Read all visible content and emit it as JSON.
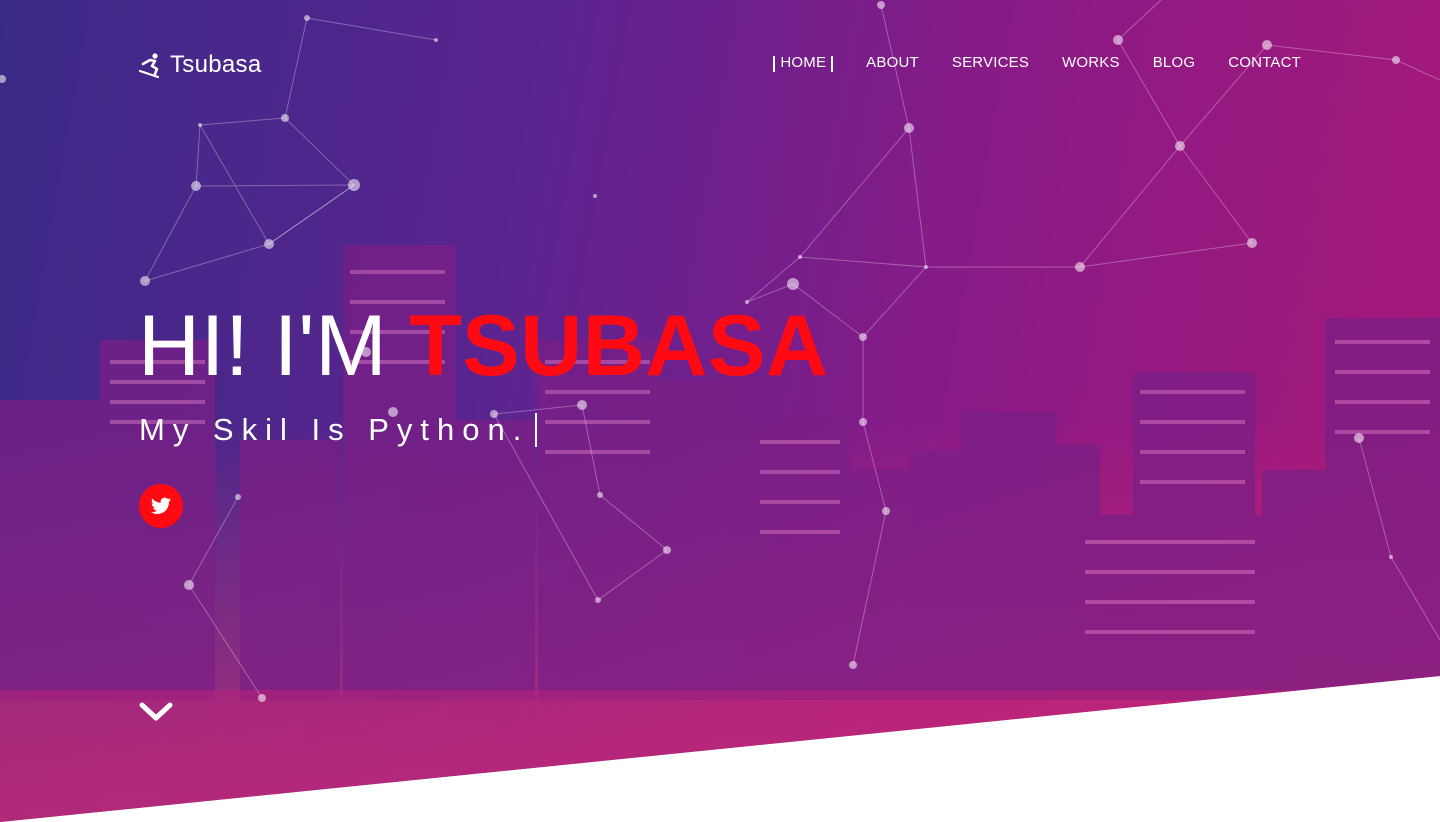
{
  "brand": {
    "name": "Tsubasa",
    "icon": "snowboarder-icon"
  },
  "nav": {
    "items": [
      {
        "label": "HOME",
        "active": true
      },
      {
        "label": "ABOUT"
      },
      {
        "label": "SERVICES"
      },
      {
        "label": "WORKS"
      },
      {
        "label": "BLOG"
      },
      {
        "label": "CONTACT"
      }
    ]
  },
  "hero": {
    "greeting": "HI! I'M",
    "name": "TSUBASA",
    "typed_text": "My Skil Is Python.",
    "social_icon": "twitter-icon",
    "scroll_icon": "chevron-down-icon"
  },
  "colors": {
    "accent": "#ff0a12",
    "gradient_start": "#3a2a86",
    "gradient_end": "#a81878",
    "text": "#ffffff"
  }
}
